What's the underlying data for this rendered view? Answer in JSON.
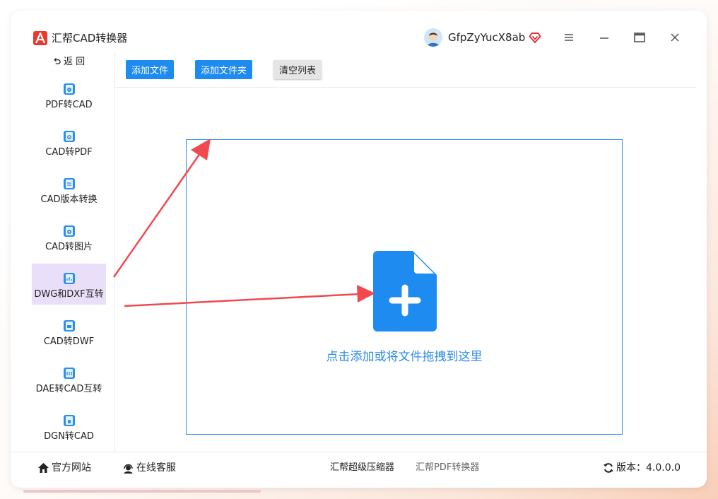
{
  "app": {
    "title": "汇帮CAD转换器"
  },
  "user": {
    "name": "GfpZyYucX8ab"
  },
  "sidebar": {
    "back_label": "返 回",
    "items": [
      {
        "label": "PDF转CAD"
      },
      {
        "label": "CAD转PDF"
      },
      {
        "label": "CAD版本转换"
      },
      {
        "label": "CAD转图片"
      },
      {
        "label": "DWG和DXF互转",
        "active": true
      },
      {
        "label": "CAD转DWF"
      },
      {
        "label": "DAE转CAD互转"
      },
      {
        "label": "DGN转CAD"
      }
    ]
  },
  "toolbar": {
    "add_file": "添加文件",
    "add_folder": "添加文件夹",
    "clear_list": "清空列表"
  },
  "dropzone": {
    "hint": "点击添加或将文件拖拽到这里"
  },
  "footer": {
    "official_site": "官方网站",
    "online_service": "在线客服",
    "compressor": "汇帮超级压缩器",
    "pdf_converter": "汇帮PDF转换器",
    "version": "版本：4.0.0.0"
  },
  "icons": {
    "app_logo": "cad-logo-icon",
    "vip": "diamond-vip-icon",
    "menu": "hamburger-menu-icon",
    "minimize": "minimize-icon",
    "maximize": "maximize-icon",
    "close": "close-icon",
    "back": "undo-arrow-icon",
    "home": "home-icon",
    "service": "headset-icon",
    "refresh": "refresh-icon",
    "file_add": "file-plus-icon"
  },
  "colors": {
    "primary": "#1e8bf0",
    "active_nav": "#eadff9",
    "hint_text": "#2b8ae6",
    "arrow": "#f04a4f",
    "logo": "#e63a2e"
  }
}
